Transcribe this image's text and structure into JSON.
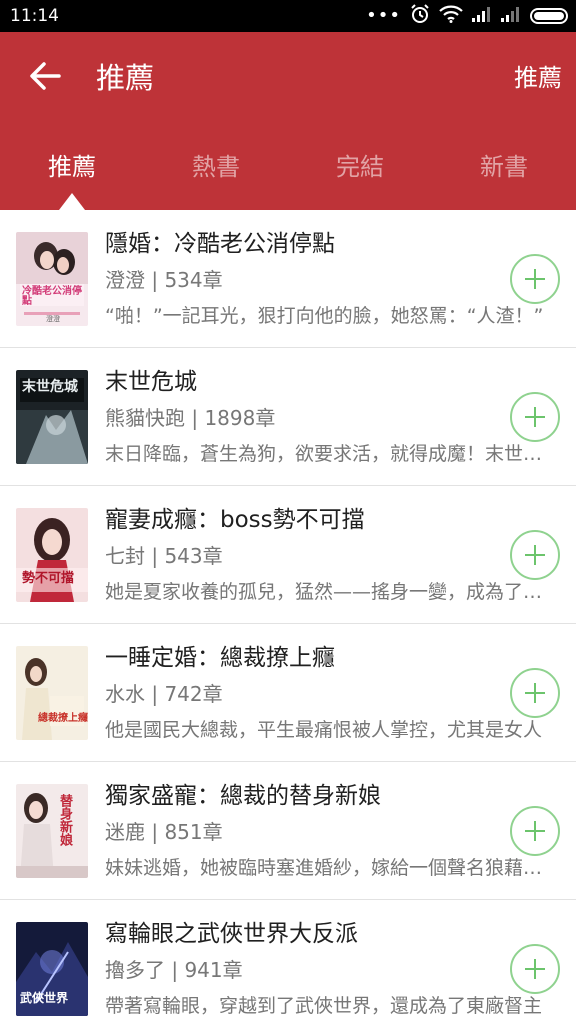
{
  "status_bar": {
    "time": "11:14",
    "icons": [
      "more-dots-icon",
      "alarm-icon",
      "wifi-icon",
      "signal-icon",
      "signal-icon",
      "battery-icon"
    ]
  },
  "app_bar": {
    "back_icon": "arrow-left-icon",
    "title": "推薦",
    "action_label": "推薦"
  },
  "tabs": [
    {
      "label": "推薦",
      "active": true
    },
    {
      "label": "熱書",
      "active": false
    },
    {
      "label": "完結",
      "active": false
    },
    {
      "label": "新書",
      "active": false
    }
  ],
  "colors": {
    "primary": "#be3338",
    "add_button": "#6cc46c"
  },
  "books": [
    {
      "title": "隱婚：冷酷老公消停點",
      "meta": "澄澄 | 534章",
      "description": "“啪！”一記耳光，狠打向他的臉，她怒罵：“人渣！”",
      "cover": {
        "text": "冷酷老公消停點",
        "author": "澄澄"
      }
    },
    {
      "title": "末世危城",
      "meta": "熊貓快跑 | 1898章",
      "description": "末日降臨，蒼生為狗，欲要求活，就得成魔！末世危城",
      "cover": {
        "text": "末世危城"
      }
    },
    {
      "title": "寵妻成癮：boss勢不可擋",
      "meta": "七封 | 543章",
      "description": "她是夏家收養的孤兒，猛然——搖身一變，成為了豪門",
      "cover": {
        "text": "勢不可擋"
      }
    },
    {
      "title": "一睡定婚：總裁撩上癮",
      "meta": "水水 | 742章",
      "description": "他是國民大總裁，平生最痛恨被人掌控，尤其是女人",
      "cover": {
        "text": "總裁撩上癮"
      }
    },
    {
      "title": "獨家盛寵：總裁的替身新娘",
      "meta": "迷鹿 | 851章",
      "description": "妹妹逃婚，她被臨時塞進婚紗，嫁給一個聲名狼藉的人",
      "cover": {
        "text": "替身新娘"
      }
    },
    {
      "title": "寫輪眼之武俠世界大反派",
      "meta": "擼多了 | 941章",
      "description": "帶著寫輪眼，穿越到了武俠世界，還成為了東廠督主",
      "cover": {
        "text": "武俠世界"
      }
    }
  ]
}
